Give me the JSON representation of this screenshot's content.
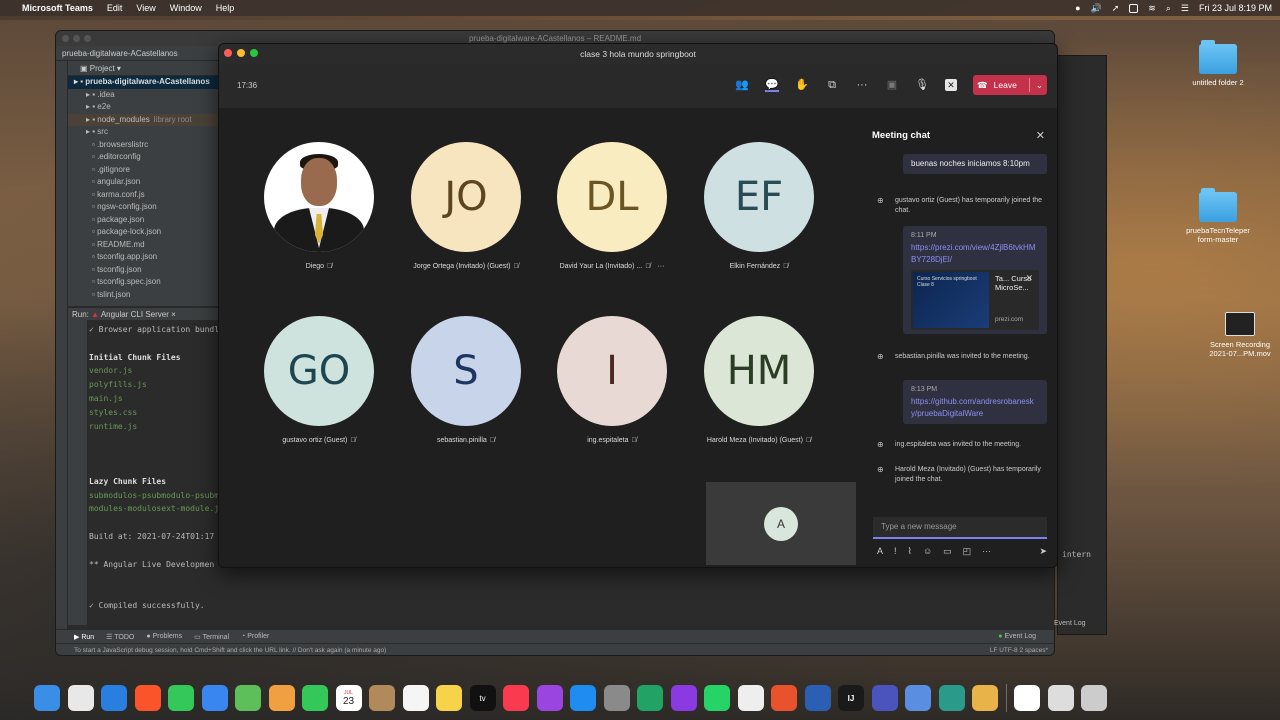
{
  "menubar": {
    "app_name": "Microsoft Teams",
    "menus": [
      "Edit",
      "View",
      "Window",
      "Help"
    ],
    "datetime": "Fri 23 Jul  8:19 PM"
  },
  "desktop": {
    "icons": [
      {
        "label": "untitled folder 2"
      },
      {
        "label": "pruebaTecnTeleper form-master"
      },
      {
        "label": "Screen Recording 2021-07...PM.mov"
      }
    ]
  },
  "ide": {
    "window_title": "prueba-digitalware-ACastellanos – README.md",
    "breadcrumb": "prueba-digitalware-ACastellanos",
    "project_header": "Project",
    "tree": [
      {
        "label": "prueba-digitalware-ACastellanos",
        "root": true
      },
      {
        "label": ".idea"
      },
      {
        "label": "e2e"
      },
      {
        "label": "node_modules",
        "suffix": "library root"
      },
      {
        "label": "src"
      },
      {
        "label": ".browserslistrc"
      },
      {
        "label": ".editorconfig"
      },
      {
        "label": ".gitignore"
      },
      {
        "label": "angular.json"
      },
      {
        "label": "karma.conf.js"
      },
      {
        "label": "ngsw-config.json"
      },
      {
        "label": "package.json"
      },
      {
        "label": "package-lock.json"
      },
      {
        "label": "README.md"
      },
      {
        "label": "tsconfig.app.json"
      },
      {
        "label": "tsconfig.json"
      },
      {
        "label": "tsconfig.spec.json"
      },
      {
        "label": "tslint.json"
      }
    ],
    "run_label": "Run:",
    "run_tab": "Angular CLI Server",
    "console_lines": [
      {
        "text": "✓ Browser application bundle",
        "style": "normal"
      },
      {
        "text": "",
        "style": "normal"
      },
      {
        "text": "Initial Chunk Files",
        "style": "bold"
      },
      {
        "text": "vendor.js",
        "style": "green"
      },
      {
        "text": "polyfills.js",
        "style": "green"
      },
      {
        "text": "main.js",
        "style": "green"
      },
      {
        "text": "styles.css",
        "style": "green"
      },
      {
        "text": "runtime.js",
        "style": "green"
      },
      {
        "text": "",
        "style": "normal"
      },
      {
        "text": "",
        "style": "normal"
      },
      {
        "text": "",
        "style": "normal"
      },
      {
        "text": "Lazy Chunk Files",
        "style": "bold"
      },
      {
        "text": "submodulos-psubmodulo-psubm",
        "style": "green"
      },
      {
        "text": "modules-modulosext-module.j",
        "style": "green"
      },
      {
        "text": "",
        "style": "normal"
      },
      {
        "text": "Build at: 2021-07-24T01:17",
        "style": "normal"
      },
      {
        "text": "",
        "style": "normal"
      },
      {
        "text": "** Angular Live Developmen",
        "style": "normal"
      },
      {
        "text": "",
        "style": "normal"
      },
      {
        "text": "",
        "style": "normal"
      },
      {
        "text": "✓ Compiled successfully.",
        "style": "normal"
      }
    ],
    "bottom_tabs": [
      "Run",
      "TODO",
      "Problems",
      "Terminal",
      "Profiler"
    ],
    "event_log": "Event Log",
    "status_text": "To start a JavaScript debug session, hold Cmd+Shift and click the URL link. // Don't ask again (a minute ago)",
    "status_right": "LF   UTF-8   2 spaces*",
    "right_window_text": "intern",
    "right_window_event_log": "Event Log"
  },
  "teams": {
    "window_title": "clase 3 hola mundo springboot",
    "elapsed": "17:36",
    "leave_label": "Leave",
    "participants": [
      {
        "name": "Diego",
        "initials": "",
        "photo": true,
        "bg": "#ffffff",
        "fg": "#000000"
      },
      {
        "name": "Jorge Ortega (Invitado) (Guest)",
        "initials": "JO",
        "bg": "#f6e5bf",
        "fg": "#5b4522"
      },
      {
        "name": "David Yaur La (Invitado) ...",
        "initials": "DL",
        "bg": "#f9ecc0",
        "fg": "#6a5524",
        "more": "···"
      },
      {
        "name": "Elkin Fernández",
        "initials": "EF",
        "bg": "#cfe0e3",
        "fg": "#294b55"
      },
      {
        "name": "gustavo ortiz (Guest)",
        "initials": "GO",
        "bg": "#cfe3de",
        "fg": "#1e4650"
      },
      {
        "name": "sebastian.pinilla",
        "initials": "S",
        "bg": "#c7d4ea",
        "fg": "#1e355f"
      },
      {
        "name": "ing.espitaleta",
        "initials": "I",
        "bg": "#e8d9d5",
        "fg": "#4a2a22"
      },
      {
        "name": "Harold Meza (Invitado) (Guest)",
        "initials": "HM",
        "bg": "#dbe6d6",
        "fg": "#2b3d25"
      }
    ],
    "self_initial": "A",
    "chat": {
      "title": "Meeting chat",
      "messages": [
        {
          "type": "bubble",
          "text": "buenas noches iniciamos 8:10pm"
        },
        {
          "type": "system",
          "text": "gustavo ortiz (Guest) has temporarily joined the chat."
        },
        {
          "type": "bubble",
          "time": "8:11 PM",
          "link": "https://prezi.com/view/4ZjlB6tvkHMBY728DjEl/",
          "card_title": "Ta... Curso MicroSe...",
          "card_domain": "prezi.com",
          "card_caption": "Curso Servicios springboot Clase 8"
        },
        {
          "type": "system",
          "text": "sebastian.pinilla was invited to the meeting."
        },
        {
          "type": "bubble",
          "time": "8:13 PM",
          "link": "https://github.com/andresrobanesky/pruebaDigitalWare"
        },
        {
          "type": "system",
          "text": "ing.espitaleta was invited to the meeting."
        },
        {
          "type": "system",
          "text": "Harold Meza (Invitado) (Guest) has temporarily joined the chat."
        }
      ],
      "composer_placeholder": "Type a new message"
    }
  },
  "dock": {
    "apps": [
      {
        "name": "Finder",
        "color": "#3b8ee6"
      },
      {
        "name": "Launchpad",
        "color": "#e8e8e8"
      },
      {
        "name": "Safari",
        "color": "#2a7ee0"
      },
      {
        "name": "Brave",
        "color": "#fb542b"
      },
      {
        "name": "Messages",
        "color": "#34c759"
      },
      {
        "name": "Mail",
        "color": "#3a86f0"
      },
      {
        "name": "Maps",
        "color": "#5cbf5a"
      },
      {
        "name": "Photos",
        "color": "#f0a040"
      },
      {
        "name": "FaceTime",
        "color": "#34c759"
      },
      {
        "name": "Calendar",
        "color": "#ffffff"
      },
      {
        "name": "Contacts",
        "color": "#b08a5a"
      },
      {
        "name": "Reminders",
        "color": "#f5f5f5"
      },
      {
        "name": "Notes",
        "color": "#f7d34a"
      },
      {
        "name": "TV",
        "color": "#111111"
      },
      {
        "name": "Music",
        "color": "#fa3a4e"
      },
      {
        "name": "Podcasts",
        "color": "#9b45e0"
      },
      {
        "name": "App Store",
        "color": "#1e8cf0"
      },
      {
        "name": "System Preferences",
        "color": "#8a8a8a"
      },
      {
        "name": "Excel",
        "color": "#21a366"
      },
      {
        "name": "Feedback",
        "color": "#8a3ae0"
      },
      {
        "name": "WhatsApp",
        "color": "#25d366"
      },
      {
        "name": "TextEdit",
        "color": "#eeeeee"
      },
      {
        "name": "Git",
        "color": "#e8532e"
      },
      {
        "name": "Word",
        "color": "#2b5fb4"
      },
      {
        "name": "IntelliJ",
        "color": "#1a1a1a"
      },
      {
        "name": "Teams",
        "color": "#4b53bc"
      },
      {
        "name": "Zoom",
        "color": "#5a8ee0"
      },
      {
        "name": "Sourcetree",
        "color": "#2a9a8a"
      },
      {
        "name": "Archive",
        "color": "#e8b44a"
      },
      {
        "name": "Downloads",
        "color": "#ffffff"
      },
      {
        "name": "Screenshots",
        "color": "#dddddd"
      },
      {
        "name": "Trash",
        "color": "#cccccc"
      }
    ],
    "calendar_day": "23",
    "calendar_month": "JUL",
    "tv_label": "tv",
    "intellij_label": "IJ"
  }
}
